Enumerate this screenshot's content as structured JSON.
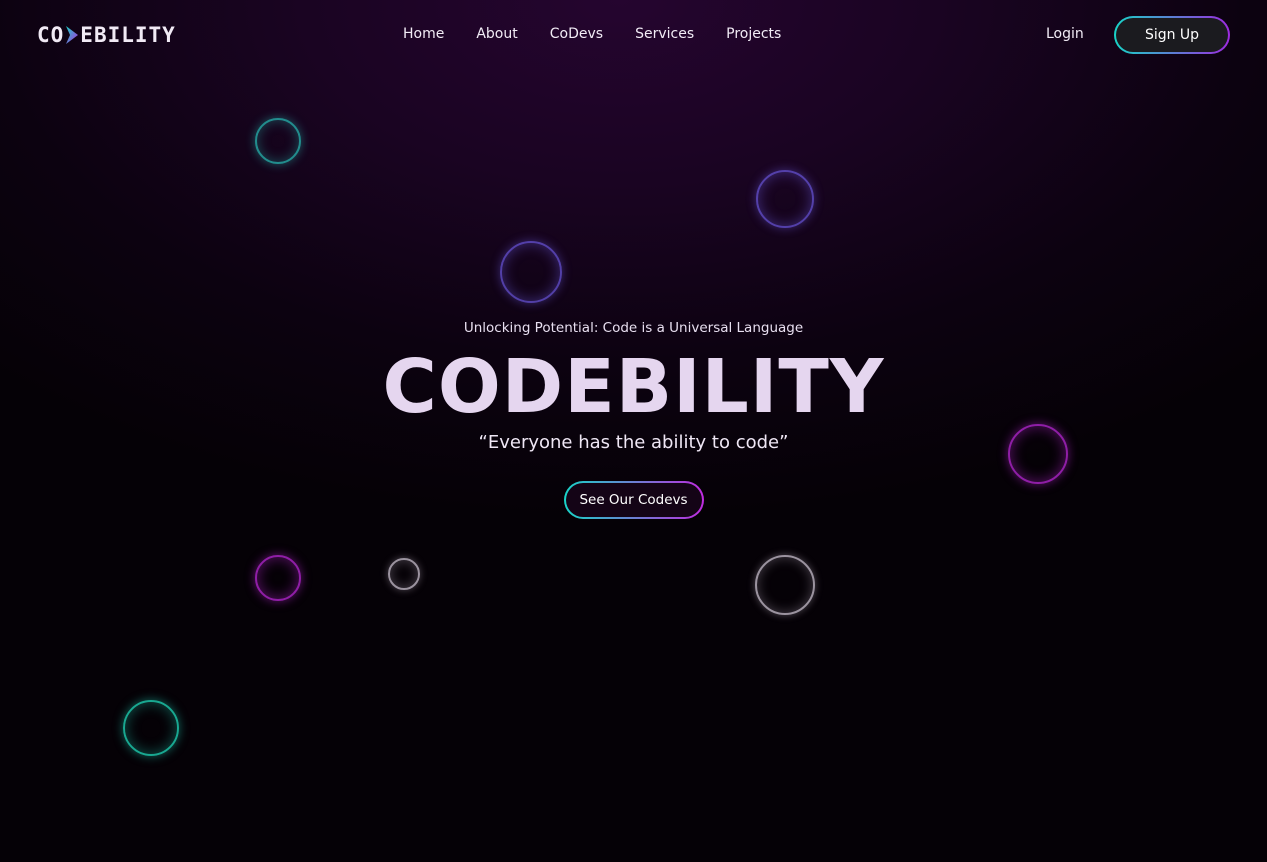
{
  "brand": {
    "logo_left": "CO",
    "logo_right": "EBILITY"
  },
  "nav": {
    "links": [
      "Home",
      "About",
      "CoDevs",
      "Services",
      "Projects"
    ],
    "login": "Login",
    "signup": "Sign Up"
  },
  "hero": {
    "tagline": "Unlocking Potential: Code is a Universal Language",
    "title": "CODEBILITY",
    "quote": "“Everyone has the ability to code”",
    "cta": "See Our Codevs"
  },
  "colors": {
    "accent_teal": "#18d4c7",
    "accent_purple": "#9d2be0",
    "background": "#0c0210"
  }
}
